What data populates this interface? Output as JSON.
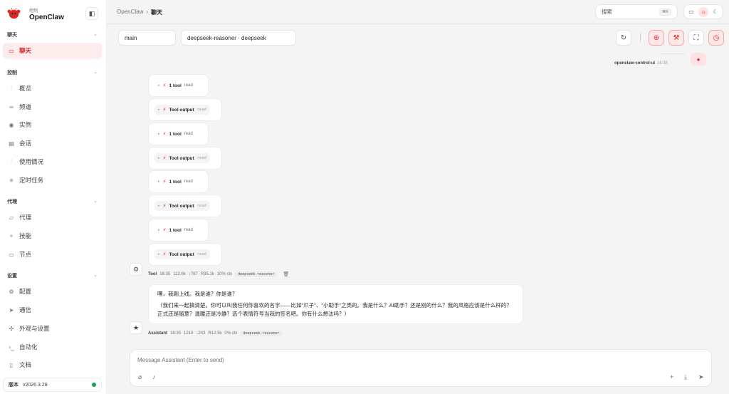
{
  "brand": {
    "subtitle": "控制",
    "name": "OpenClaw"
  },
  "sidebar": {
    "groups": [
      {
        "label": "聊天",
        "items": [
          {
            "label": "聊天",
            "icon": "chat-bubble-icon",
            "active": true
          }
        ]
      },
      {
        "label": "控制",
        "items": [
          {
            "label": "概览",
            "icon": "bar-chart-icon"
          },
          {
            "label": "频道",
            "icon": "link-icon"
          },
          {
            "label": "实例",
            "icon": "broadcast-icon"
          },
          {
            "label": "会话",
            "icon": "document-icon"
          },
          {
            "label": "使用情况",
            "icon": "bar-chart-icon"
          },
          {
            "label": "定时任务",
            "icon": "loader-icon"
          }
        ]
      },
      {
        "label": "代理",
        "items": [
          {
            "label": "代理",
            "icon": "folder-icon"
          },
          {
            "label": "技能",
            "icon": "sparkle-icon"
          },
          {
            "label": "节点",
            "icon": "monitor-icon"
          }
        ]
      },
      {
        "label": "设置",
        "items": [
          {
            "label": "配置",
            "icon": "gear-icon"
          },
          {
            "label": "通信",
            "icon": "send-icon"
          },
          {
            "label": "外观与设置",
            "icon": "palette-icon"
          },
          {
            "label": "自动化",
            "icon": "terminal-icon"
          },
          {
            "label": "文档",
            "icon": "book-icon"
          }
        ]
      }
    ],
    "version_label": "版本",
    "version": "v2026.3.28",
    "status_color": "#16a34a"
  },
  "topbar": {
    "breadcrumb_root": "OpenClaw",
    "breadcrumb_current": "聊天",
    "search_placeholder": "搜索",
    "search_shortcut": "⌘K"
  },
  "chat_controls": {
    "session": "main",
    "model": "deepseek-reasoner · deepseek"
  },
  "user_message": {
    "sender": "openclaw-control-ui",
    "time": "16:35"
  },
  "tool_group": {
    "cards": [
      {
        "kind": "call",
        "label": "1 tool",
        "tag": "read"
      },
      {
        "kind": "output",
        "label": "Tool output",
        "tag": "read"
      },
      {
        "kind": "call",
        "label": "1 tool",
        "tag": "read"
      },
      {
        "kind": "output",
        "label": "Tool output",
        "tag": "read"
      },
      {
        "kind": "call",
        "label": "1 tool",
        "tag": "read"
      },
      {
        "kind": "output",
        "label": "Tool output",
        "tag": "read"
      },
      {
        "kind": "call",
        "label": "1 tool",
        "tag": "read"
      },
      {
        "kind": "output",
        "label": "Tool output",
        "tag": "read"
      }
    ],
    "meta": {
      "sender": "Tool",
      "time": "16:35",
      "input": "112.6k",
      "output": "↓787",
      "read": "R35.1k",
      "ctx": "10% ctx",
      "model": "deepseek-reasoner"
    }
  },
  "assistant_message": {
    "line1": "嘿，我刚上线。我是谁？你是谁？",
    "line2": "（我们来一起搞清楚。你可以叫我任何你喜欢的名字——比如\"爪子\"、\"小助手\"之类的。我是什么？AI助手？还是别的什么？我的风格应该是什么样的？正式还是随意？温暖还是冷静？选个表情符号当我的签名吧。你有什么想法吗？）",
    "meta": {
      "sender": "Assistant",
      "time": "16:35",
      "input": "1210",
      "output": "↓243",
      "read": "R12.5k",
      "ctx": "0% ctx",
      "model": "deepseek-reasoner"
    }
  },
  "composer": {
    "placeholder": "Message Assistant (Enter to send)"
  },
  "colors": {
    "accent": "#dc2626",
    "accent_soft": "#fde8e8",
    "background": "#f4f4f5"
  }
}
